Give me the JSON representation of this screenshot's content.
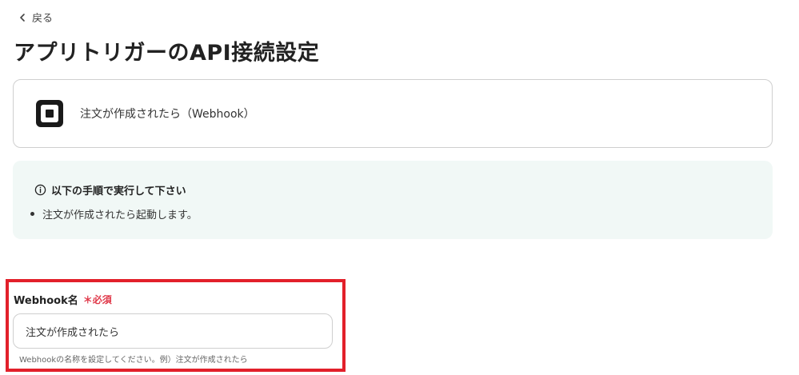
{
  "nav": {
    "back_label": "戻る"
  },
  "page": {
    "title": "アプリトリガーのAPI接続設定"
  },
  "trigger": {
    "app_icon": "square-logo-icon",
    "label": "注文が作成されたら（Webhook）"
  },
  "info": {
    "heading": "以下の手順で実行して下さい",
    "items": [
      "注文が作成されたら起動します。"
    ]
  },
  "form": {
    "webhook_name": {
      "label": "Webhook名",
      "required_label": "＊必須",
      "value": "注文が作成されたら",
      "help": "Webhookの名称を設定してください。例）注文が作成されたら"
    }
  },
  "colors": {
    "highlight": "#e2202a",
    "required": "#e0394a",
    "info_bg": "#f1f8f6"
  }
}
